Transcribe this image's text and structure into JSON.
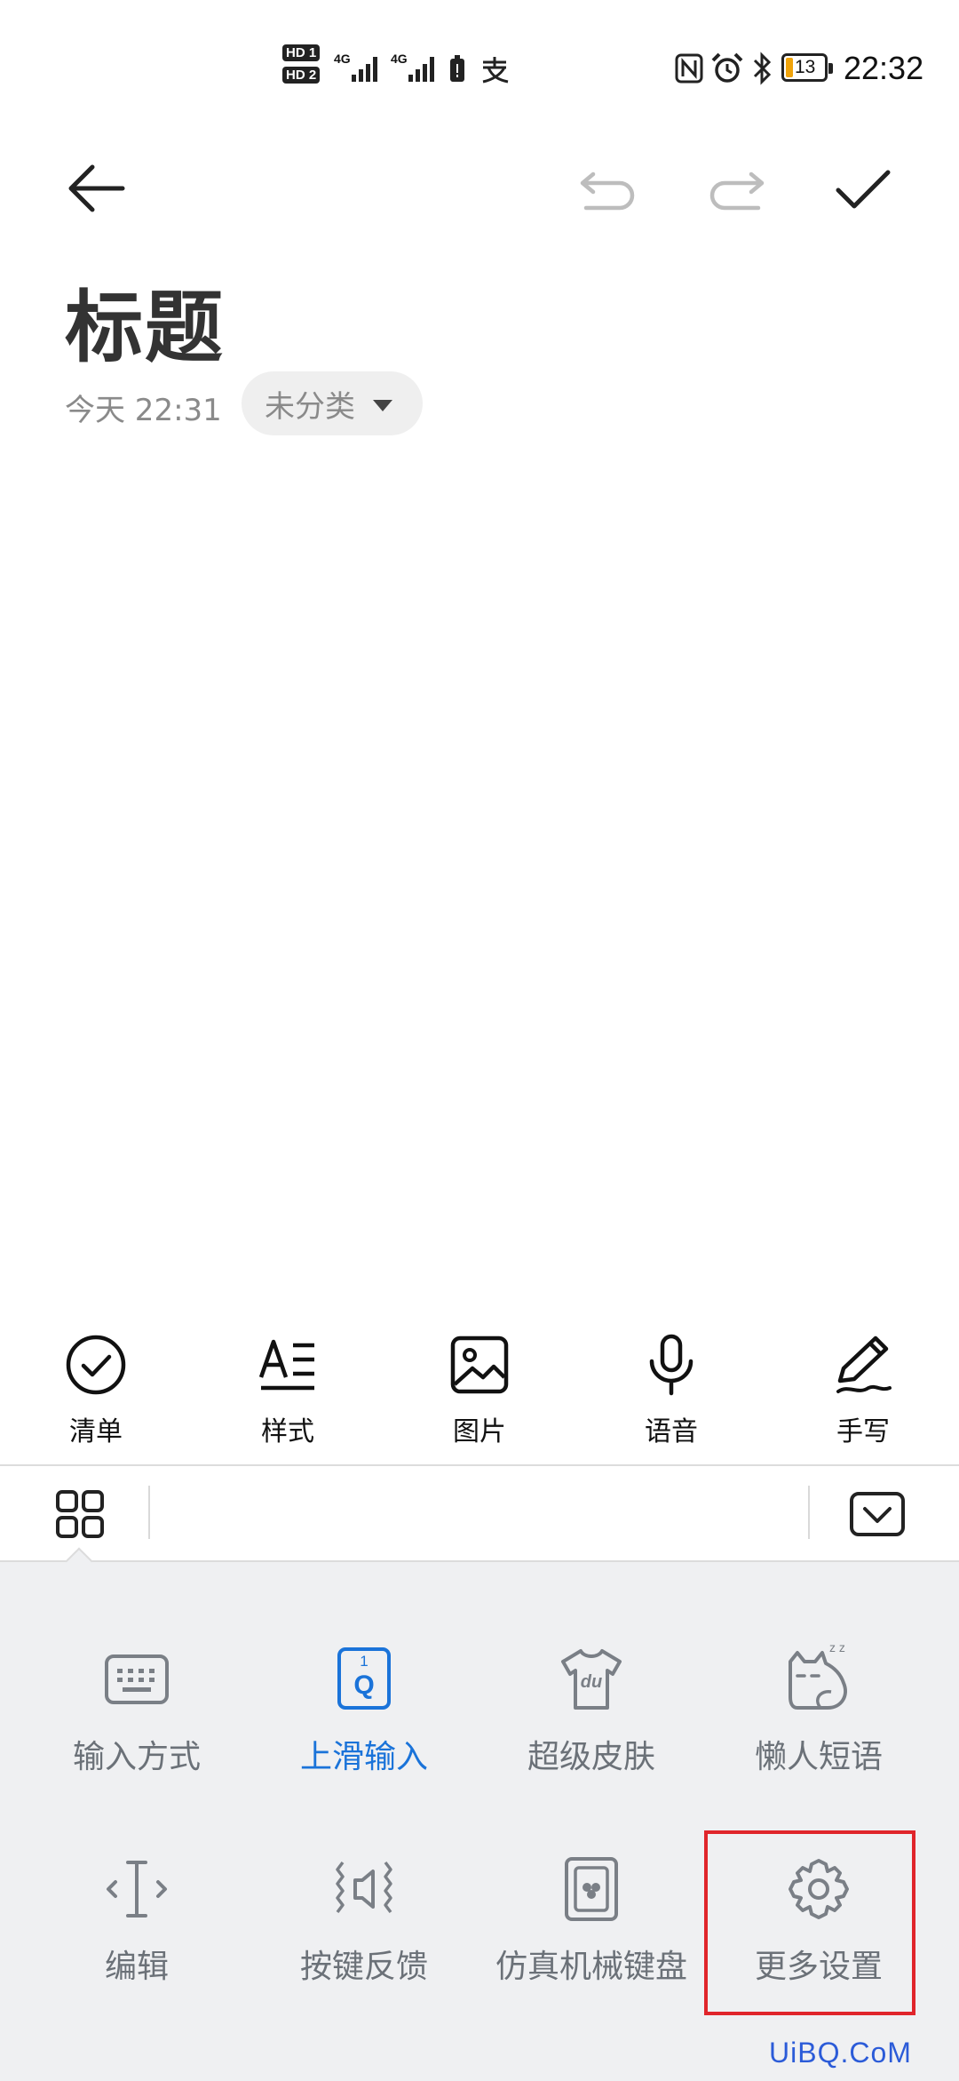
{
  "status_bar": {
    "sim1": "HD 1",
    "sim2": "HD 2",
    "net1": "4G",
    "net2": "4G",
    "battery": "13",
    "time": "22:32",
    "icons": [
      "signal-icon",
      "battery-saver-icon",
      "alipay-icon",
      "nfc-icon",
      "alarm-icon",
      "bluetooth-icon",
      "battery-icon"
    ]
  },
  "toolbar": {
    "icons": [
      "back-arrow-icon",
      "undo-icon",
      "redo-icon",
      "check-icon"
    ]
  },
  "note": {
    "title": "标题",
    "date": "今天 22:31",
    "category": "未分类"
  },
  "note_tools": [
    {
      "label": "清单",
      "icon": "checklist-icon"
    },
    {
      "label": "样式",
      "icon": "text-style-icon"
    },
    {
      "label": "图片",
      "icon": "image-icon"
    },
    {
      "label": "语音",
      "icon": "microphone-icon"
    },
    {
      "label": "手写",
      "icon": "pen-icon"
    }
  ],
  "keyboard": {
    "menu_icon": "grid-menu-icon",
    "collapse_icon": "keyboard-collapse-icon",
    "items": [
      {
        "label": "输入方式",
        "icon": "keyboard-icon"
      },
      {
        "label": "上滑输入",
        "icon": "swipe-up-key-icon",
        "key_top": "1",
        "key_main": "Q",
        "active": true
      },
      {
        "label": "超级皮肤",
        "icon": "tshirt-icon",
        "shirt_text": "du"
      },
      {
        "label": "懒人短语",
        "icon": "lazy-cat-icon",
        "sleep_text": "z z"
      },
      {
        "label": "编辑",
        "icon": "text-cursor-icon"
      },
      {
        "label": "按键反馈",
        "icon": "vibration-sound-icon"
      },
      {
        "label": "仿真机械键盘",
        "icon": "mechanical-key-icon"
      },
      {
        "label": "更多设置",
        "icon": "gear-icon"
      }
    ],
    "accent_color": "#1a73d9"
  },
  "watermark": "UiBQ.CoM",
  "colors": {
    "highlight": "#e0252b",
    "panel_bg": "#eff0f2"
  }
}
